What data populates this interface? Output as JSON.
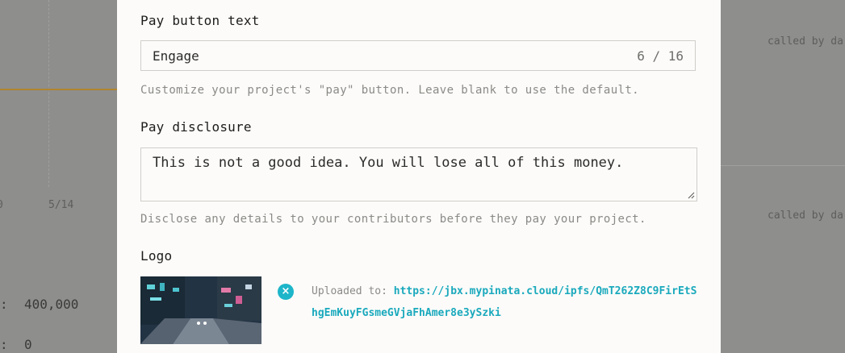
{
  "background": {
    "x_tick_left": "0",
    "x_tick_right": "5/14",
    "stats": [
      {
        "sep": ":",
        "value": "400,000"
      },
      {
        "sep": ":",
        "value": "0"
      }
    ],
    "called_by": [
      "called by da",
      "called by da"
    ]
  },
  "modal": {
    "pay_button": {
      "label": "Pay button text",
      "value": "Engage",
      "counter": "6 / 16",
      "help": "Customize your project's \"pay\" button. Leave blank to use the default."
    },
    "pay_disclosure": {
      "label": "Pay disclosure",
      "value": "This is not a good idea. You will lose all of this money.",
      "help": "Disclose any details to your contributors before they pay your project."
    },
    "logo": {
      "label": "Logo",
      "remove_icon": "×",
      "uploaded_prefix": "Uploaded to: ",
      "url": "https://jbx.mypinata.cloud/ipfs/QmT262Z8C9FirEtShgEmKuyFGsmeGVjaFhAmer8e3ySzki"
    }
  },
  "colors": {
    "accent": "#1db5c9",
    "chart_line": "#b0842f"
  }
}
